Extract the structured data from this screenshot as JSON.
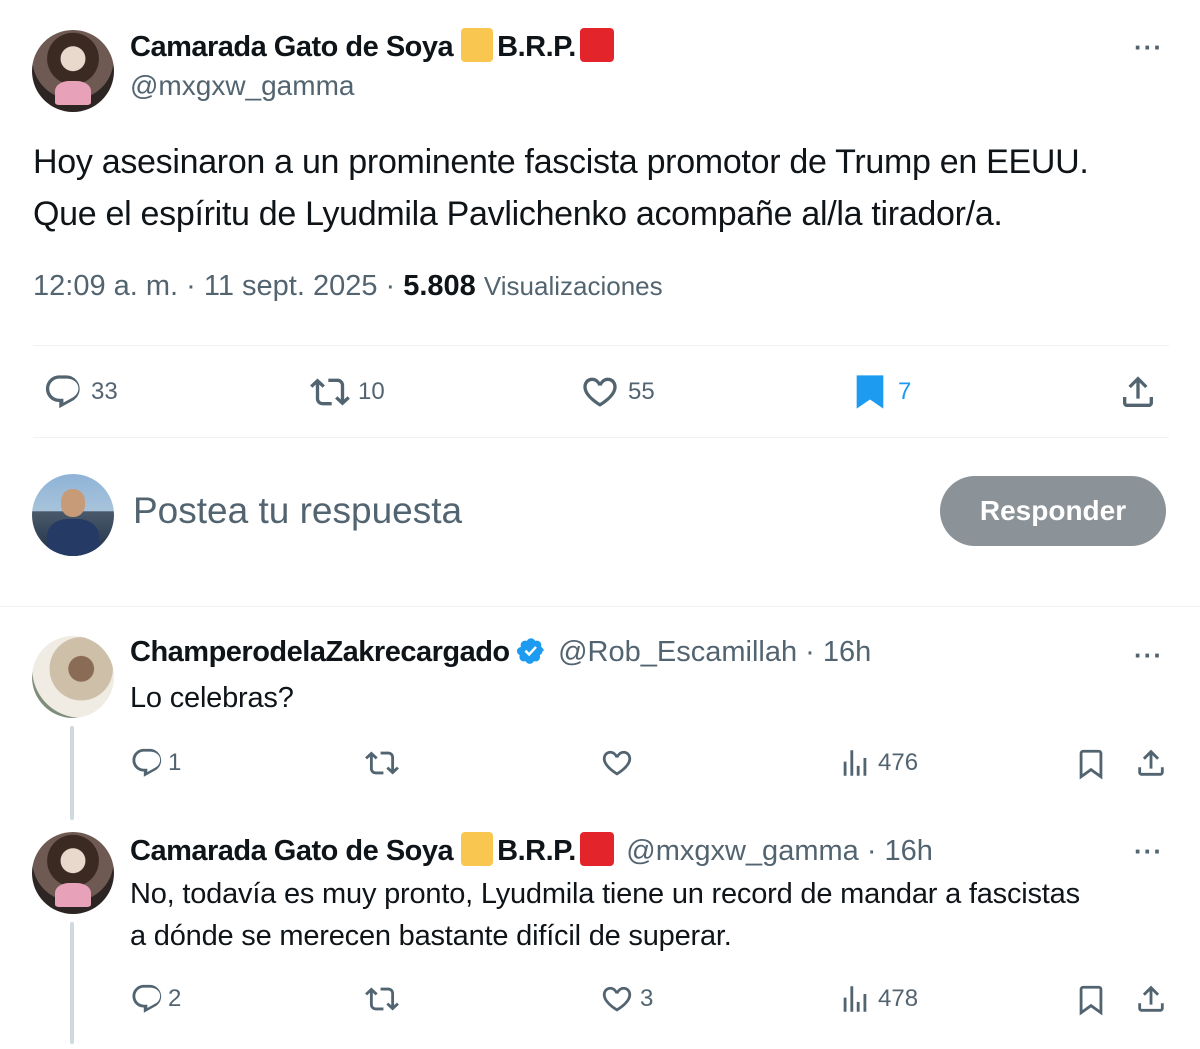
{
  "main_post": {
    "author_name": "Camarada Gato de Soya",
    "author_flag_text": "B.R.P.",
    "handle": "@mxgxw_gamma",
    "more": "···",
    "text_line1": "Hoy asesinaron a un prominente fascista promotor de Trump en EEUU.",
    "text_line2": "Que el espíritu de Lyudmila Pavlichenko acompañe al/la tirador/a.",
    "time": "12:09 a. m. · 11 sept. 2025 · ",
    "views_count": "5.808",
    "views_label": "Visualizaciones",
    "replies": "33",
    "reposts": "10",
    "likes": "55",
    "bookmarks": "7"
  },
  "composer": {
    "placeholder": "Postea tu respuesta",
    "button_label": "Responder"
  },
  "replies": [
    {
      "author_name": "ChamperodelaZakrecargado",
      "handle_time": "@Rob_Escamillah · 16h",
      "more": "···",
      "text_line1": "Lo celebras?",
      "replies": "1",
      "reposts": "",
      "likes": "",
      "views": "476"
    },
    {
      "author_name": "Camarada Gato de Soya",
      "author_flag_text": "B.R.P.",
      "handle_time": "@mxgxw_gamma · 16h",
      "more": "···",
      "text_line1": "No, todavía es muy pronto, Lyudmila tiene un record de mandar a fascistas",
      "text_line2": "a dónde se merecen bastante difícil de superar.",
      "replies": "2",
      "reposts": "",
      "likes": "3",
      "views": "478"
    }
  ],
  "colors": {
    "accent_blue": "#1d9bf0",
    "muted": "#536471",
    "button_gray": "#8b9298"
  }
}
